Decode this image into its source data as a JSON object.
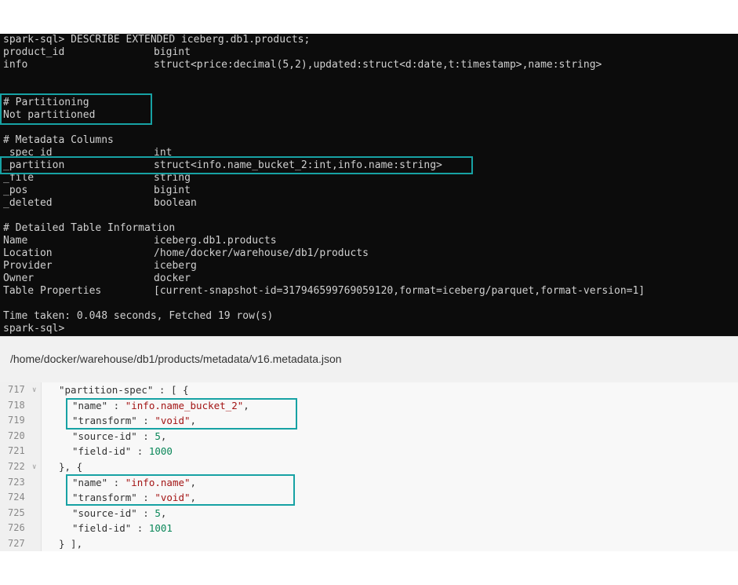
{
  "terminal": {
    "command": "spark-sql> DESCRIBE EXTENDED iceberg.db1.products;",
    "columns": [
      {
        "name": "product_id",
        "type": "bigint"
      },
      {
        "name": "info",
        "type": "struct<price:decimal(5,2),updated:struct<d:date,t:timestamp>,name:string>"
      }
    ],
    "partitioning": {
      "header": "# Partitioning",
      "value": "Not partitioned"
    },
    "metadata_columns": {
      "header": "# Metadata Columns",
      "rows": [
        {
          "name": "_spec_id",
          "type": "int"
        },
        {
          "name": "_partition",
          "type": "struct<info.name_bucket_2:int,info.name:string>"
        },
        {
          "name": "_file",
          "type": "string"
        },
        {
          "name": "_pos",
          "type": "bigint"
        },
        {
          "name": "_deleted",
          "type": "boolean"
        }
      ]
    },
    "detailed_info": {
      "header": "# Detailed Table Information",
      "rows": [
        {
          "name": "Name",
          "value": "iceberg.db1.products"
        },
        {
          "name": "Location",
          "value": "/home/docker/warehouse/db1/products"
        },
        {
          "name": "Provider",
          "value": "iceberg"
        },
        {
          "name": "Owner",
          "value": "docker"
        },
        {
          "name": "Table Properties",
          "value": "[current-snapshot-id=317946599769059120,format=iceberg/parquet,format-version=1]"
        }
      ]
    },
    "time_taken": "Time taken: 0.048 seconds, Fetched 19 row(s)",
    "prompt": "spark-sql>"
  },
  "file_path": "/home/docker/warehouse/db1/products/metadata/v16.metadata.json",
  "editor": {
    "line_717": {
      "num": "717",
      "code": "\"partition-spec\" : [ {"
    },
    "line_718": {
      "num": "718",
      "key": "\"name\" : ",
      "str": "\"info.name_bucket_2\"",
      "tail": ","
    },
    "line_719": {
      "num": "719",
      "key": "\"transform\" : ",
      "str": "\"void\"",
      "tail": ","
    },
    "line_720": {
      "num": "720",
      "key": "\"source-id\" : ",
      "val": "5",
      "tail": ","
    },
    "line_721": {
      "num": "721",
      "key": "\"field-id\" : ",
      "val": "1000"
    },
    "line_722": {
      "num": "722",
      "code": "}, {"
    },
    "line_723": {
      "num": "723",
      "key": "\"name\" : ",
      "str": "\"info.name\"",
      "tail": ","
    },
    "line_724": {
      "num": "724",
      "key": "\"transform\" : ",
      "str": "\"void\"",
      "tail": ","
    },
    "line_725": {
      "num": "725",
      "key": "\"source-id\" : ",
      "val": "5",
      "tail": ","
    },
    "line_726": {
      "num": "726",
      "key": "\"field-id\" : ",
      "val": "1001"
    },
    "line_727": {
      "num": "727",
      "code": "} ],"
    },
    "fold_icon": "chevron-down"
  },
  "colors": {
    "highlight": "#17a2a4",
    "terminal_bg": "#0c0c0c",
    "terminal_text": "#d0d0d0",
    "string": "#a31515",
    "number": "#098658"
  }
}
